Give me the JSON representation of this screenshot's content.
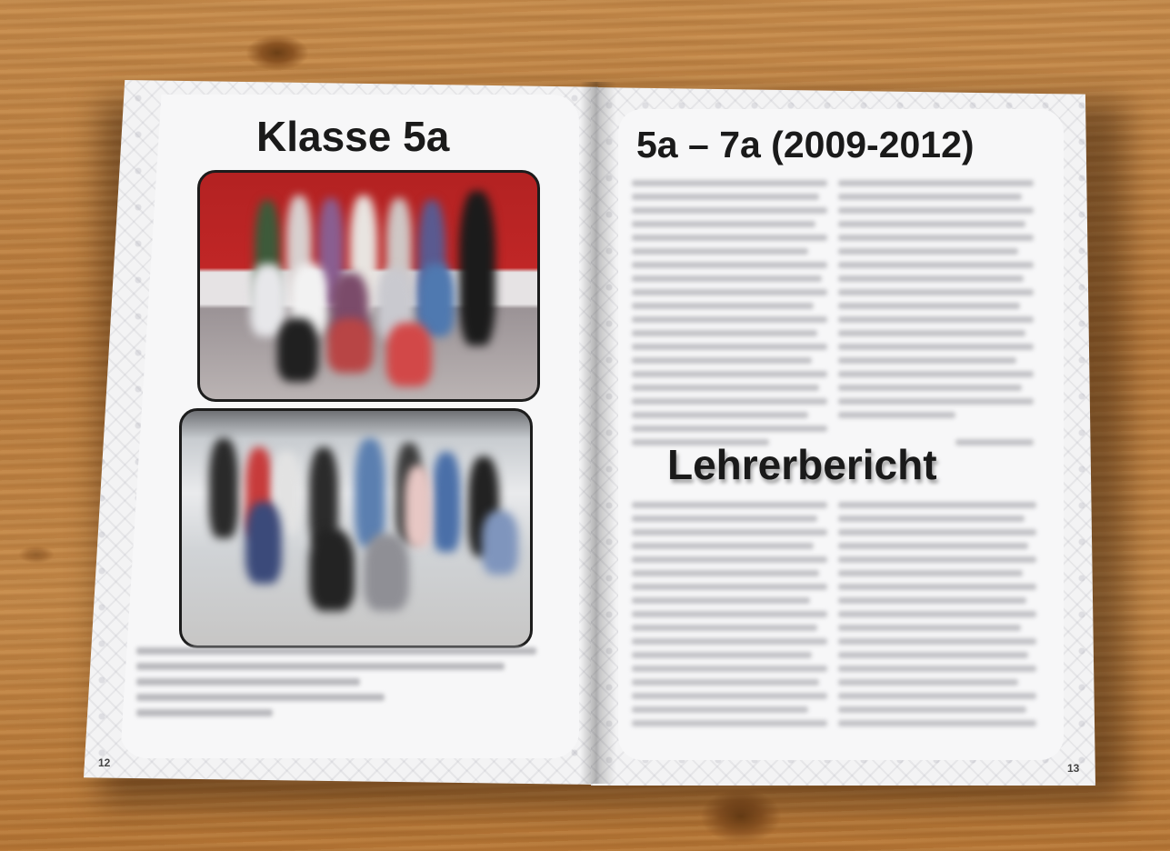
{
  "left_page": {
    "title": "Klasse 5a",
    "page_number": "12"
  },
  "right_page": {
    "title": "5a – 7a (2009-2012)",
    "section_title": "Lehrerbericht",
    "page_number": "13"
  },
  "colors": {
    "wood": "#b97b3d",
    "photo1_backdrop": "#c02626",
    "page": "#f3f3f4"
  }
}
